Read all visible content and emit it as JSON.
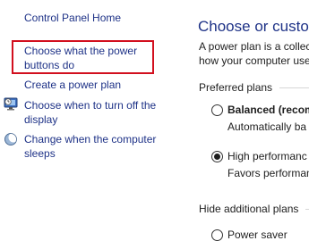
{
  "nav": {
    "control_panel_home": "Control Panel Home",
    "power_buttons_line1": "Choose what the power",
    "power_buttons_line2": "buttons do",
    "create_plan": "Create a power plan",
    "turn_off_display_line1": "Choose when to turn off the",
    "turn_off_display_line2": "display",
    "sleep_line1": "Change when the computer",
    "sleep_line2": "sleeps"
  },
  "main": {
    "title": "Choose or custom",
    "description_line1": "A power plan is a collec",
    "description_line2": "how your computer use",
    "preferred_plans_label": "Preferred plans",
    "plans": [
      {
        "name": "Balanced (recom",
        "description": "Automatically ba",
        "selected": false
      },
      {
        "name": "High performanc",
        "description": "Favors performan",
        "selected": true
      }
    ],
    "hide_plans_label": "Hide additional plans",
    "additional_plans": [
      {
        "name": "Power saver",
        "selected": false
      }
    ]
  },
  "colors": {
    "link": "#1e3287",
    "highlight_border": "#d20f1e"
  },
  "icons": {
    "display": "monitor-clock-icon",
    "sleep": "moon-icon"
  }
}
